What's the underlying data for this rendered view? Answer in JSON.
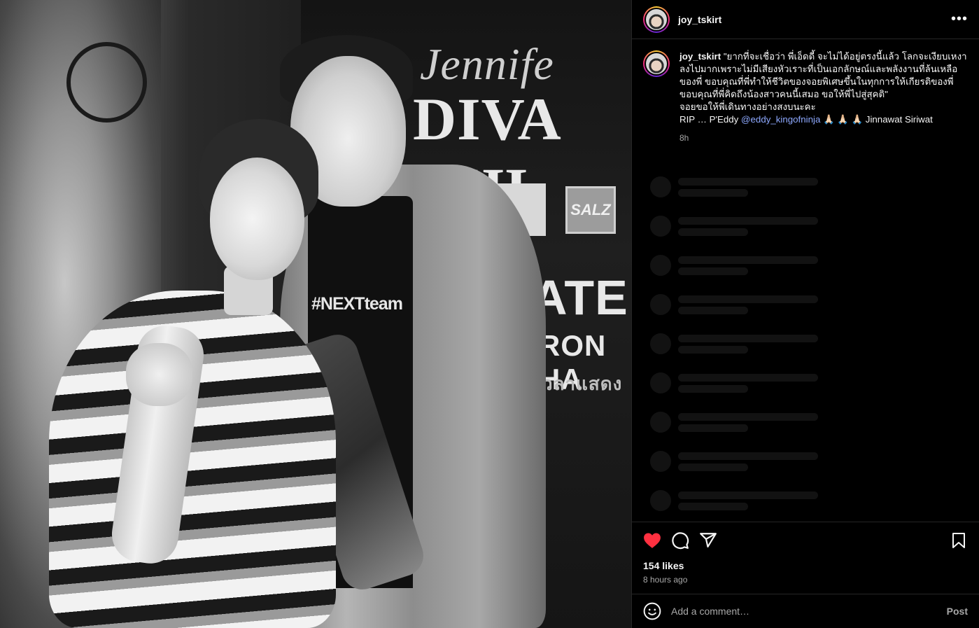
{
  "post": {
    "username": "joy_tskirt",
    "more_icon": "more-horizontal-icon"
  },
  "photo": {
    "poster_line1": "Jennife",
    "poster_line2": "DIVA CHI",
    "poster_line3": "ATE",
    "poster_line4": "RON HA",
    "poster_line5": "วลาแสดง",
    "logo_text": "SALZ",
    "shirt_text": "#NEXTteam"
  },
  "caption": {
    "username": "joy_tskirt",
    "text_part1": "\"ยากที่จะเชื่อว่า พี่เอ็ดดี้ จะไม่ได้อยู่ตรงนี้แล้ว โลกจะเงียบเหงาลงไปมากเพราะไม่มีเสียงหัวเราะที่เป็นเอกลักษณ์และพลังงานที่ล้นเหลือของพี่ ขอบคุณที่พี่ทำให้ชีวิตของจอยพิเศษขึ้นในทุกการให้เกียรติของพี่ ขอบคุณที่พี่คิดถึงน้องสาวคนนี้เสมอ ขอให้พี่ไปสู่สุคติ\"",
    "text_part2": "จอยขอให้พี่เดินทางอย่างสงบนะคะ",
    "text_part3": "RIP … P'Eddy",
    "mention": "@eddy_kingofninja",
    "text_part4": "🙏🏻 🙏🏻 🙏🏻 Jinnawat Siriwat",
    "time": "8h"
  },
  "skeleton_rows": 9,
  "actions": {
    "like_icon": "heart-filled-icon",
    "comment_icon": "comment-icon",
    "share_icon": "share-icon",
    "save_icon": "bookmark-icon",
    "like_color": "#ff3040"
  },
  "likes_text": "154 likes",
  "time_ago": "8 hours ago",
  "comment": {
    "placeholder": "Add a comment…",
    "post_label": "Post",
    "emoji_icon": "emoji-icon"
  }
}
